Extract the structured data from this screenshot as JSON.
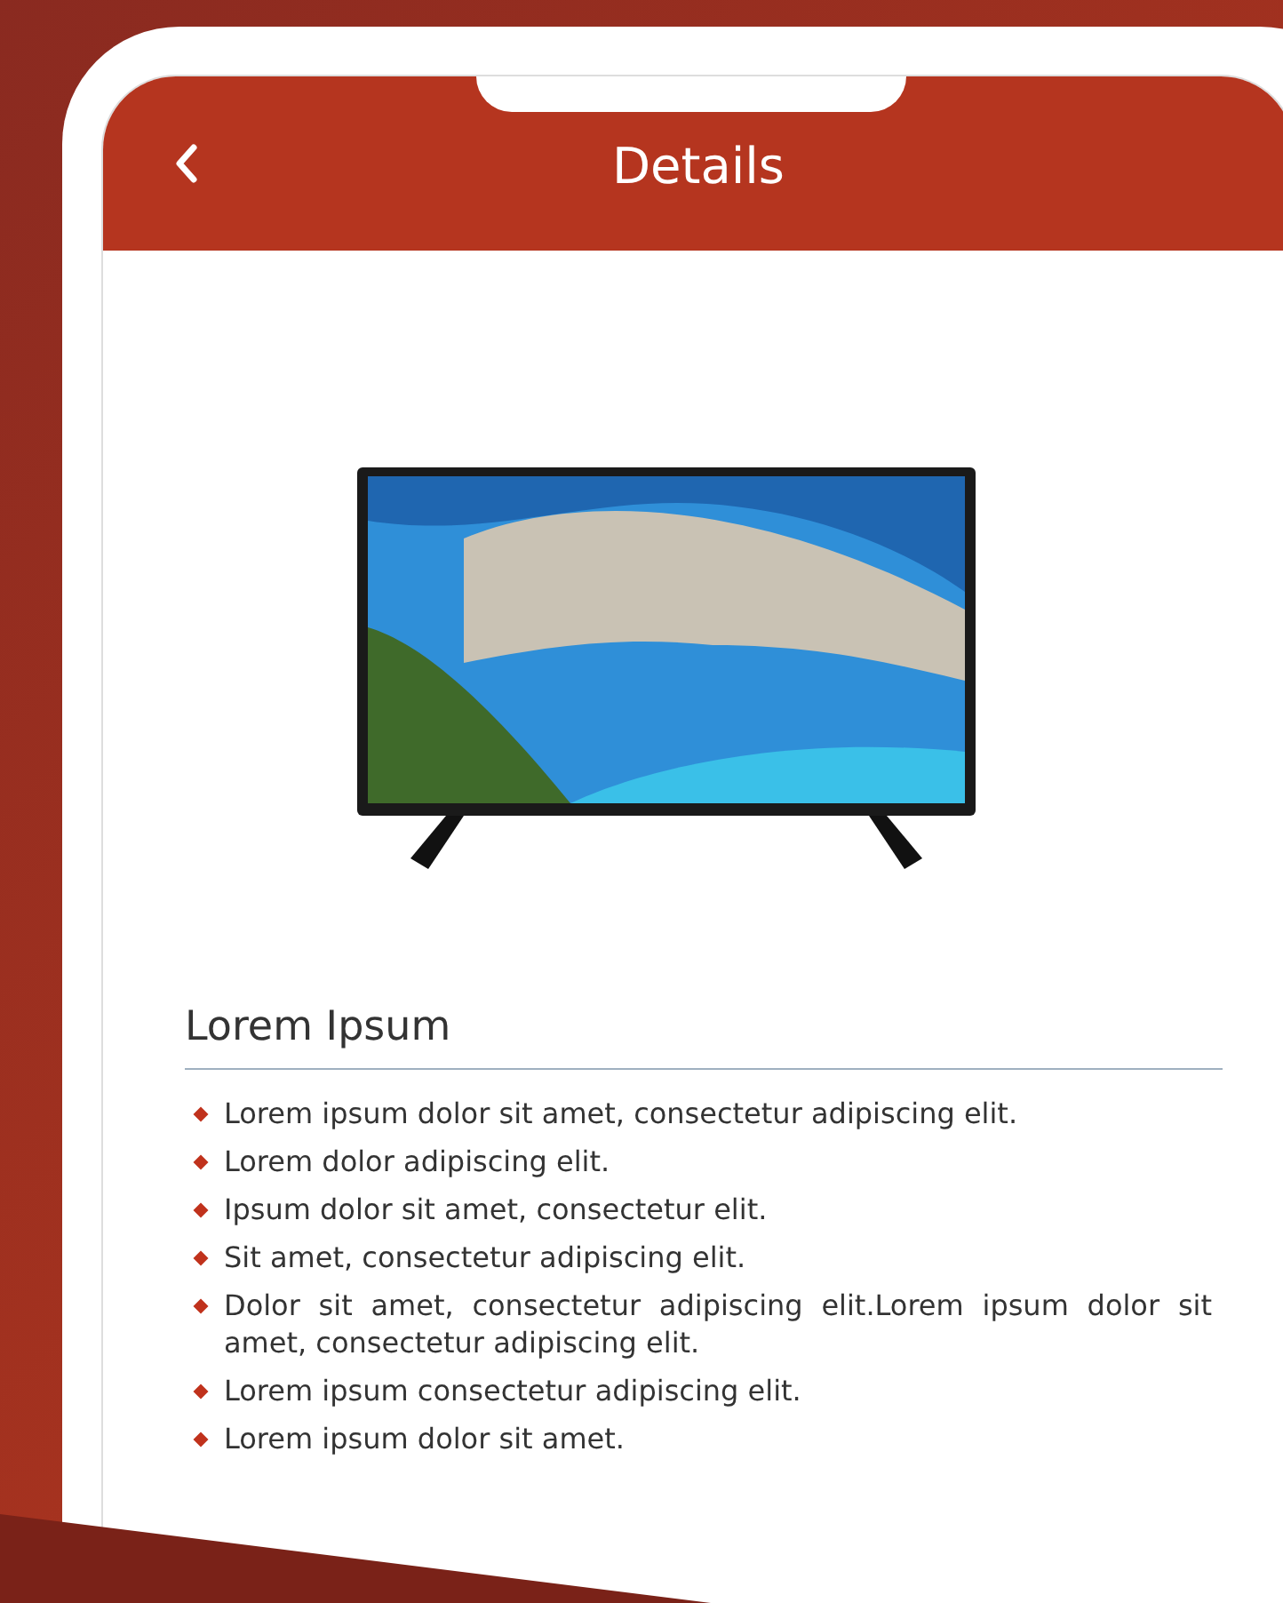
{
  "header": {
    "title": "Details"
  },
  "section": {
    "title": "Lorem Ipsum",
    "bullets": [
      "Lorem ipsum dolor sit amet, consectetur adipiscing elit.",
      "Lorem dolor adipiscing elit.",
      "Ipsum dolor sit amet, consectetur elit.",
      "Sit amet, consectetur adipiscing elit.",
      "Dolor sit amet, consectetur adipiscing elit.Lorem ipsum dolor sit amet, consectetur adipiscing elit.",
      "Lorem ipsum consectetur adipiscing elit.",
      "Lorem ipsum dolor sit amet."
    ]
  }
}
